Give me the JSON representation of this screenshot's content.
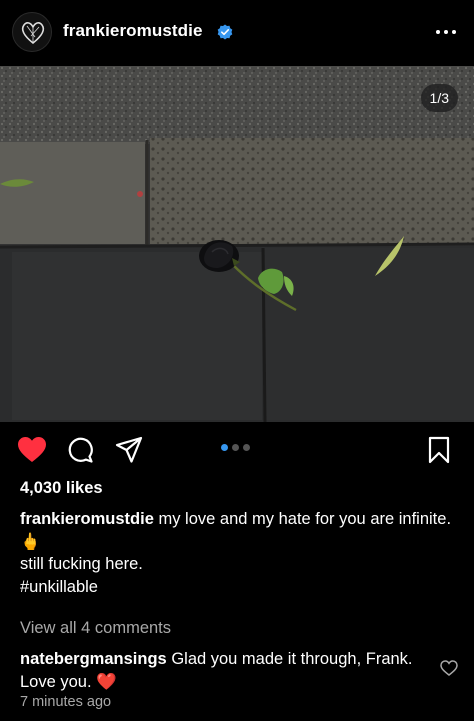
{
  "header": {
    "username": "frankieromustdie",
    "verified": true,
    "avatar_icon": "heart-sketch-logo",
    "more_icon": "more-horizontal-icon"
  },
  "post": {
    "image_description_icon": "black-rose-on-pavement-photo",
    "carousel": {
      "counter": "1/3",
      "current": 1,
      "total": 3
    }
  },
  "actions": {
    "liked": true,
    "like_color": "#ff3040",
    "accent": "#3797f0"
  },
  "likes": "4,030 likes",
  "caption": {
    "username": "frankieromustdie",
    "line1": "my love and my hate for you are infinite.",
    "emoji": "🖕",
    "line2": "still fucking here.",
    "hashtag": "#unkillable"
  },
  "view_comments": "View all 4 comments",
  "comment": {
    "username": "natebergmansings",
    "text": "Glad you made it through, Frank. Love you.",
    "emoji": "❤️"
  },
  "timestamp": "7 minutes ago"
}
